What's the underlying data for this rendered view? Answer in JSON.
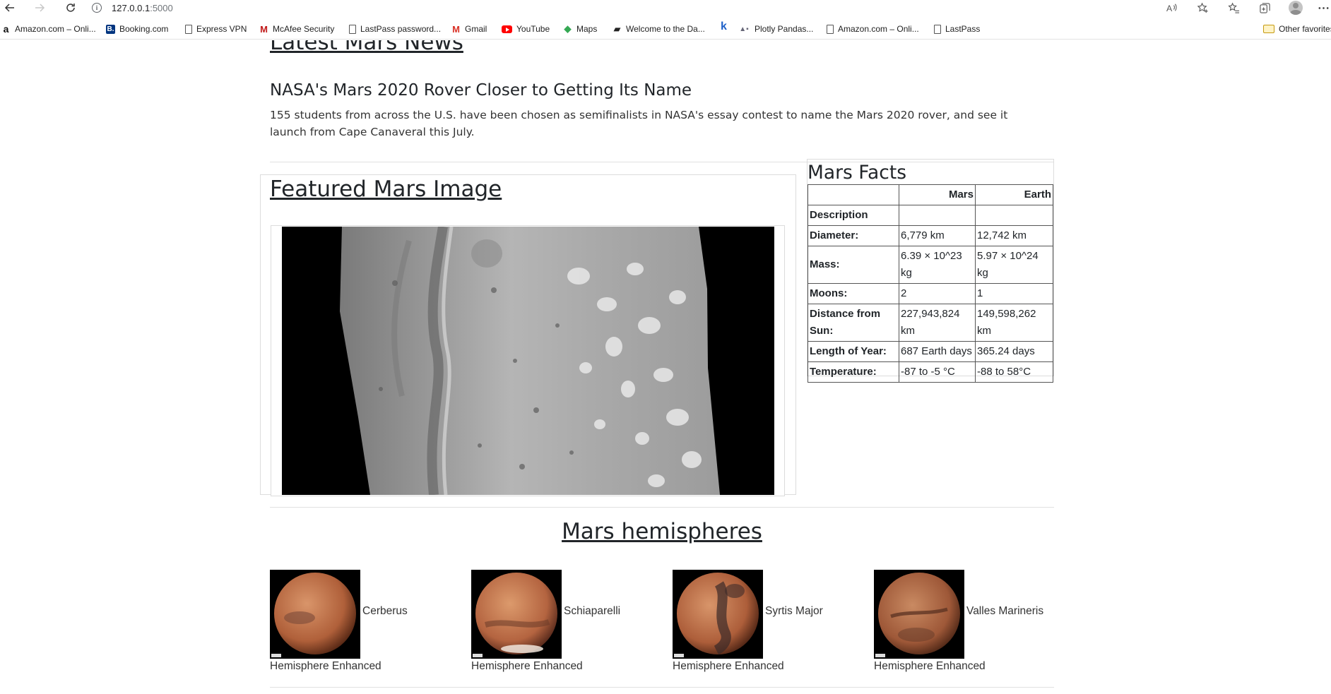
{
  "browser": {
    "url_host": "127.0.0.1",
    "url_port": ":5000",
    "bookmarks": [
      {
        "label": "Amazon.com – Onli...",
        "icon": "amazon-icon"
      },
      {
        "label": "Booking.com",
        "icon": "booking-icon"
      },
      {
        "label": "Express VPN",
        "icon": "document-icon"
      },
      {
        "label": "McAfee Security",
        "icon": "mcafee-icon"
      },
      {
        "label": "LastPass password...",
        "icon": "document-icon"
      },
      {
        "label": "Gmail",
        "icon": "gmail-icon"
      },
      {
        "label": "YouTube",
        "icon": "youtube-icon"
      },
      {
        "label": "Maps",
        "icon": "maps-icon"
      },
      {
        "label": "Welcome to the Da...",
        "icon": "book-icon"
      },
      {
        "label": "",
        "icon": "k-icon"
      },
      {
        "label": "Plotly Pandas...",
        "icon": "plotly-icon"
      },
      {
        "label": "Amazon.com – Onli...",
        "icon": "document-icon"
      },
      {
        "label": "LastPass",
        "icon": "document-icon"
      }
    ],
    "other_favorites": "Other favorites"
  },
  "news": {
    "section_title": "Latest Mars News",
    "headline": "NASA's Mars 2020 Rover Closer to Getting Its Name",
    "paragraph": "155 students from across the U.S. have been chosen as semifinalists in NASA's essay contest to name the Mars 2020 rover, and see it launch from Cape Canaveral this July."
  },
  "featured": {
    "title": "Featured Mars Image"
  },
  "facts": {
    "title": "Mars Facts",
    "headers": [
      "",
      "Mars",
      "Earth"
    ],
    "rows": [
      {
        "label": "Description",
        "mars": "",
        "earth": ""
      },
      {
        "label": "Diameter:",
        "mars": "6,779 km",
        "earth": "12,742 km"
      },
      {
        "label": "Mass:",
        "mars": "6.39 × 10^23 kg",
        "earth": "5.97 × 10^24 kg"
      },
      {
        "label": "Moons:",
        "mars": "2",
        "earth": "1"
      },
      {
        "label": "Distance from Sun:",
        "mars": "227,943,824 km",
        "earth": "149,598,262 km"
      },
      {
        "label": "Length of Year:",
        "mars": "687 Earth days",
        "earth": "365.24 days"
      },
      {
        "label": "Temperature:",
        "mars": "-87 to -5 °C",
        "earth": "-88 to 58°C"
      }
    ]
  },
  "hemispheres": {
    "title": "Mars hemispheres",
    "items": [
      {
        "name": "Cerberus",
        "subtitle": "Hemisphere Enhanced"
      },
      {
        "name": "Schiaparelli",
        "subtitle": "Hemisphere Enhanced"
      },
      {
        "name": "Syrtis Major",
        "subtitle": "Hemisphere Enhanced"
      },
      {
        "name": "Valles Marineris",
        "subtitle": "Hemisphere Enhanced"
      }
    ]
  }
}
